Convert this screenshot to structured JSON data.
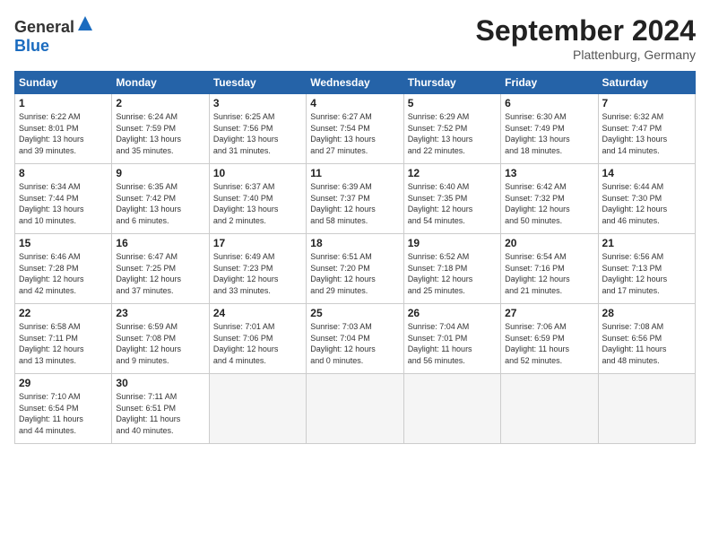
{
  "header": {
    "logo_general": "General",
    "logo_blue": "Blue",
    "title": "September 2024",
    "location": "Plattenburg, Germany"
  },
  "columns": [
    "Sunday",
    "Monday",
    "Tuesday",
    "Wednesday",
    "Thursday",
    "Friday",
    "Saturday"
  ],
  "weeks": [
    [
      {
        "day": "1",
        "info": "Sunrise: 6:22 AM\nSunset: 8:01 PM\nDaylight: 13 hours\nand 39 minutes."
      },
      {
        "day": "2",
        "info": "Sunrise: 6:24 AM\nSunset: 7:59 PM\nDaylight: 13 hours\nand 35 minutes."
      },
      {
        "day": "3",
        "info": "Sunrise: 6:25 AM\nSunset: 7:56 PM\nDaylight: 13 hours\nand 31 minutes."
      },
      {
        "day": "4",
        "info": "Sunrise: 6:27 AM\nSunset: 7:54 PM\nDaylight: 13 hours\nand 27 minutes."
      },
      {
        "day": "5",
        "info": "Sunrise: 6:29 AM\nSunset: 7:52 PM\nDaylight: 13 hours\nand 22 minutes."
      },
      {
        "day": "6",
        "info": "Sunrise: 6:30 AM\nSunset: 7:49 PM\nDaylight: 13 hours\nand 18 minutes."
      },
      {
        "day": "7",
        "info": "Sunrise: 6:32 AM\nSunset: 7:47 PM\nDaylight: 13 hours\nand 14 minutes."
      }
    ],
    [
      {
        "day": "8",
        "info": "Sunrise: 6:34 AM\nSunset: 7:44 PM\nDaylight: 13 hours\nand 10 minutes."
      },
      {
        "day": "9",
        "info": "Sunrise: 6:35 AM\nSunset: 7:42 PM\nDaylight: 13 hours\nand 6 minutes."
      },
      {
        "day": "10",
        "info": "Sunrise: 6:37 AM\nSunset: 7:40 PM\nDaylight: 13 hours\nand 2 minutes."
      },
      {
        "day": "11",
        "info": "Sunrise: 6:39 AM\nSunset: 7:37 PM\nDaylight: 12 hours\nand 58 minutes."
      },
      {
        "day": "12",
        "info": "Sunrise: 6:40 AM\nSunset: 7:35 PM\nDaylight: 12 hours\nand 54 minutes."
      },
      {
        "day": "13",
        "info": "Sunrise: 6:42 AM\nSunset: 7:32 PM\nDaylight: 12 hours\nand 50 minutes."
      },
      {
        "day": "14",
        "info": "Sunrise: 6:44 AM\nSunset: 7:30 PM\nDaylight: 12 hours\nand 46 minutes."
      }
    ],
    [
      {
        "day": "15",
        "info": "Sunrise: 6:46 AM\nSunset: 7:28 PM\nDaylight: 12 hours\nand 42 minutes."
      },
      {
        "day": "16",
        "info": "Sunrise: 6:47 AM\nSunset: 7:25 PM\nDaylight: 12 hours\nand 37 minutes."
      },
      {
        "day": "17",
        "info": "Sunrise: 6:49 AM\nSunset: 7:23 PM\nDaylight: 12 hours\nand 33 minutes."
      },
      {
        "day": "18",
        "info": "Sunrise: 6:51 AM\nSunset: 7:20 PM\nDaylight: 12 hours\nand 29 minutes."
      },
      {
        "day": "19",
        "info": "Sunrise: 6:52 AM\nSunset: 7:18 PM\nDaylight: 12 hours\nand 25 minutes."
      },
      {
        "day": "20",
        "info": "Sunrise: 6:54 AM\nSunset: 7:16 PM\nDaylight: 12 hours\nand 21 minutes."
      },
      {
        "day": "21",
        "info": "Sunrise: 6:56 AM\nSunset: 7:13 PM\nDaylight: 12 hours\nand 17 minutes."
      }
    ],
    [
      {
        "day": "22",
        "info": "Sunrise: 6:58 AM\nSunset: 7:11 PM\nDaylight: 12 hours\nand 13 minutes."
      },
      {
        "day": "23",
        "info": "Sunrise: 6:59 AM\nSunset: 7:08 PM\nDaylight: 12 hours\nand 9 minutes."
      },
      {
        "day": "24",
        "info": "Sunrise: 7:01 AM\nSunset: 7:06 PM\nDaylight: 12 hours\nand 4 minutes."
      },
      {
        "day": "25",
        "info": "Sunrise: 7:03 AM\nSunset: 7:04 PM\nDaylight: 12 hours\nand 0 minutes."
      },
      {
        "day": "26",
        "info": "Sunrise: 7:04 AM\nSunset: 7:01 PM\nDaylight: 11 hours\nand 56 minutes."
      },
      {
        "day": "27",
        "info": "Sunrise: 7:06 AM\nSunset: 6:59 PM\nDaylight: 11 hours\nand 52 minutes."
      },
      {
        "day": "28",
        "info": "Sunrise: 7:08 AM\nSunset: 6:56 PM\nDaylight: 11 hours\nand 48 minutes."
      }
    ],
    [
      {
        "day": "29",
        "info": "Sunrise: 7:10 AM\nSunset: 6:54 PM\nDaylight: 11 hours\nand 44 minutes."
      },
      {
        "day": "30",
        "info": "Sunrise: 7:11 AM\nSunset: 6:51 PM\nDaylight: 11 hours\nand 40 minutes."
      },
      {
        "day": "",
        "info": ""
      },
      {
        "day": "",
        "info": ""
      },
      {
        "day": "",
        "info": ""
      },
      {
        "day": "",
        "info": ""
      },
      {
        "day": "",
        "info": ""
      }
    ]
  ]
}
